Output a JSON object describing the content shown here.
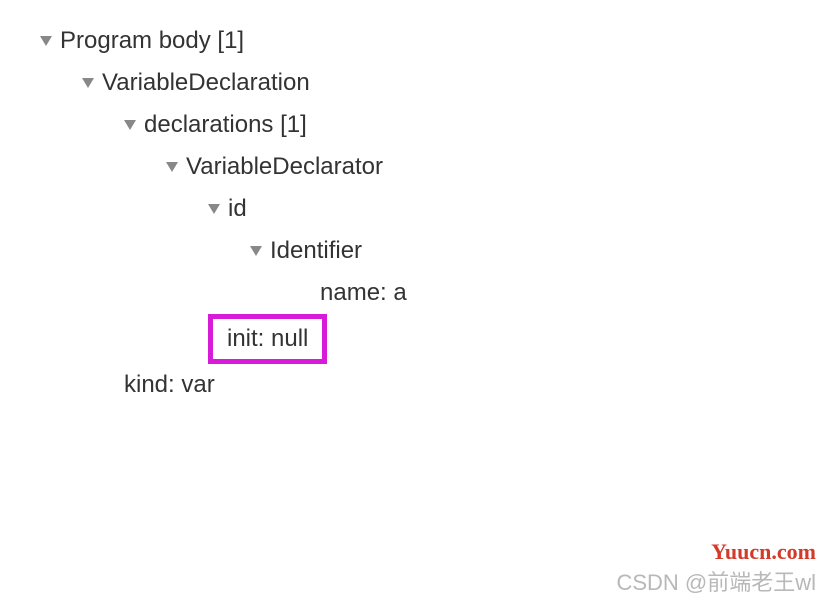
{
  "tree": {
    "root": {
      "label": "Program body [1]",
      "child1": {
        "label": "VariableDeclaration",
        "declarations": {
          "label": "declarations [1]",
          "declarator": {
            "label": "VariableDeclarator",
            "id": {
              "label": "id",
              "identifier": {
                "label": "Identifier",
                "name_label": "name: a"
              }
            },
            "init_label": "init: null"
          }
        },
        "kind_label": "kind: var"
      }
    }
  },
  "watermarks": {
    "yuucn": "Yuucn.com",
    "csdn": "CSDN @前端老王wl"
  }
}
